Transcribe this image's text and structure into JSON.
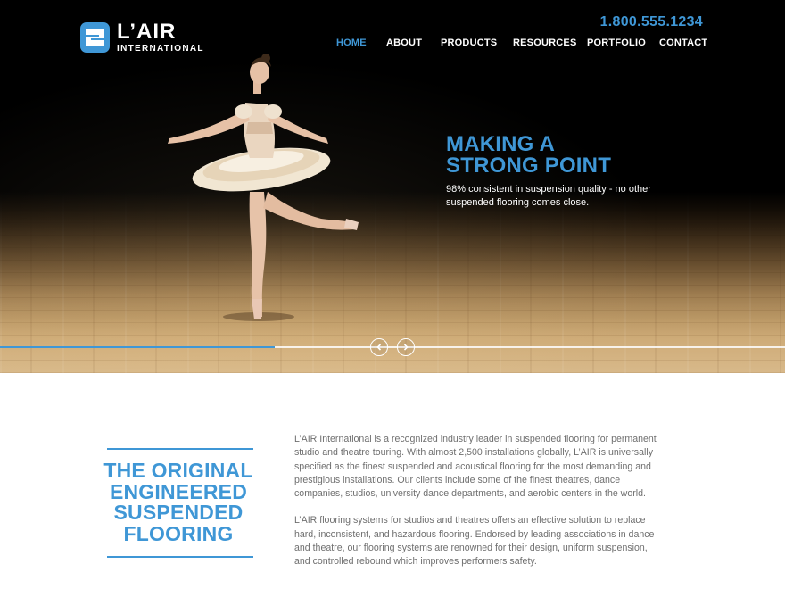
{
  "brand": {
    "name": "L’AIR",
    "subtitle": "INTERNATIONAL",
    "accent_color": "#3f97d6"
  },
  "header": {
    "phone": "1.800.555.1234"
  },
  "nav": {
    "items": [
      {
        "label": "HOME",
        "active": true
      },
      {
        "label": "ABOUT",
        "active": false
      },
      {
        "label": "PRODUCTS",
        "active": false
      },
      {
        "label": "RESOURCES",
        "active": false
      },
      {
        "label": "PORTFOLIO",
        "active": false
      },
      {
        "label": "CONTACT",
        "active": false
      }
    ]
  },
  "hero": {
    "title_line1": "MAKING A",
    "title_line2": "STRONG POINT",
    "description": "98% consistent in suspension quality - no other suspended flooring comes close.",
    "slider_progress": 0.35,
    "prev_icon": "chevron-left-icon",
    "next_icon": "chevron-right-icon"
  },
  "feature": {
    "heading_lines": [
      "THE ORIGINAL",
      "ENGINEERED",
      "SUSPENDED",
      "FLOORING"
    ],
    "paragraph1": "L’AIR International is a recognized industry leader in suspended flooring for permanent studio and theatre touring. With almost 2,500 installations globally, L’AIR is universally specified as the finest suspended and acoustical flooring for the most demanding and prestigious installations. Our clients include some of the finest theatres, dance companies, studios, university dance departments, and aerobic centers in the world.",
    "paragraph2": "L’AIR flooring systems for studios and theatres offers an effective solution to replace hard, inconsistent, and hazardous flooring. Endorsed by leading associations in dance and theatre, our flooring systems are renowned for their design, uniform suspension, and controlled rebound which improves performers safety."
  }
}
